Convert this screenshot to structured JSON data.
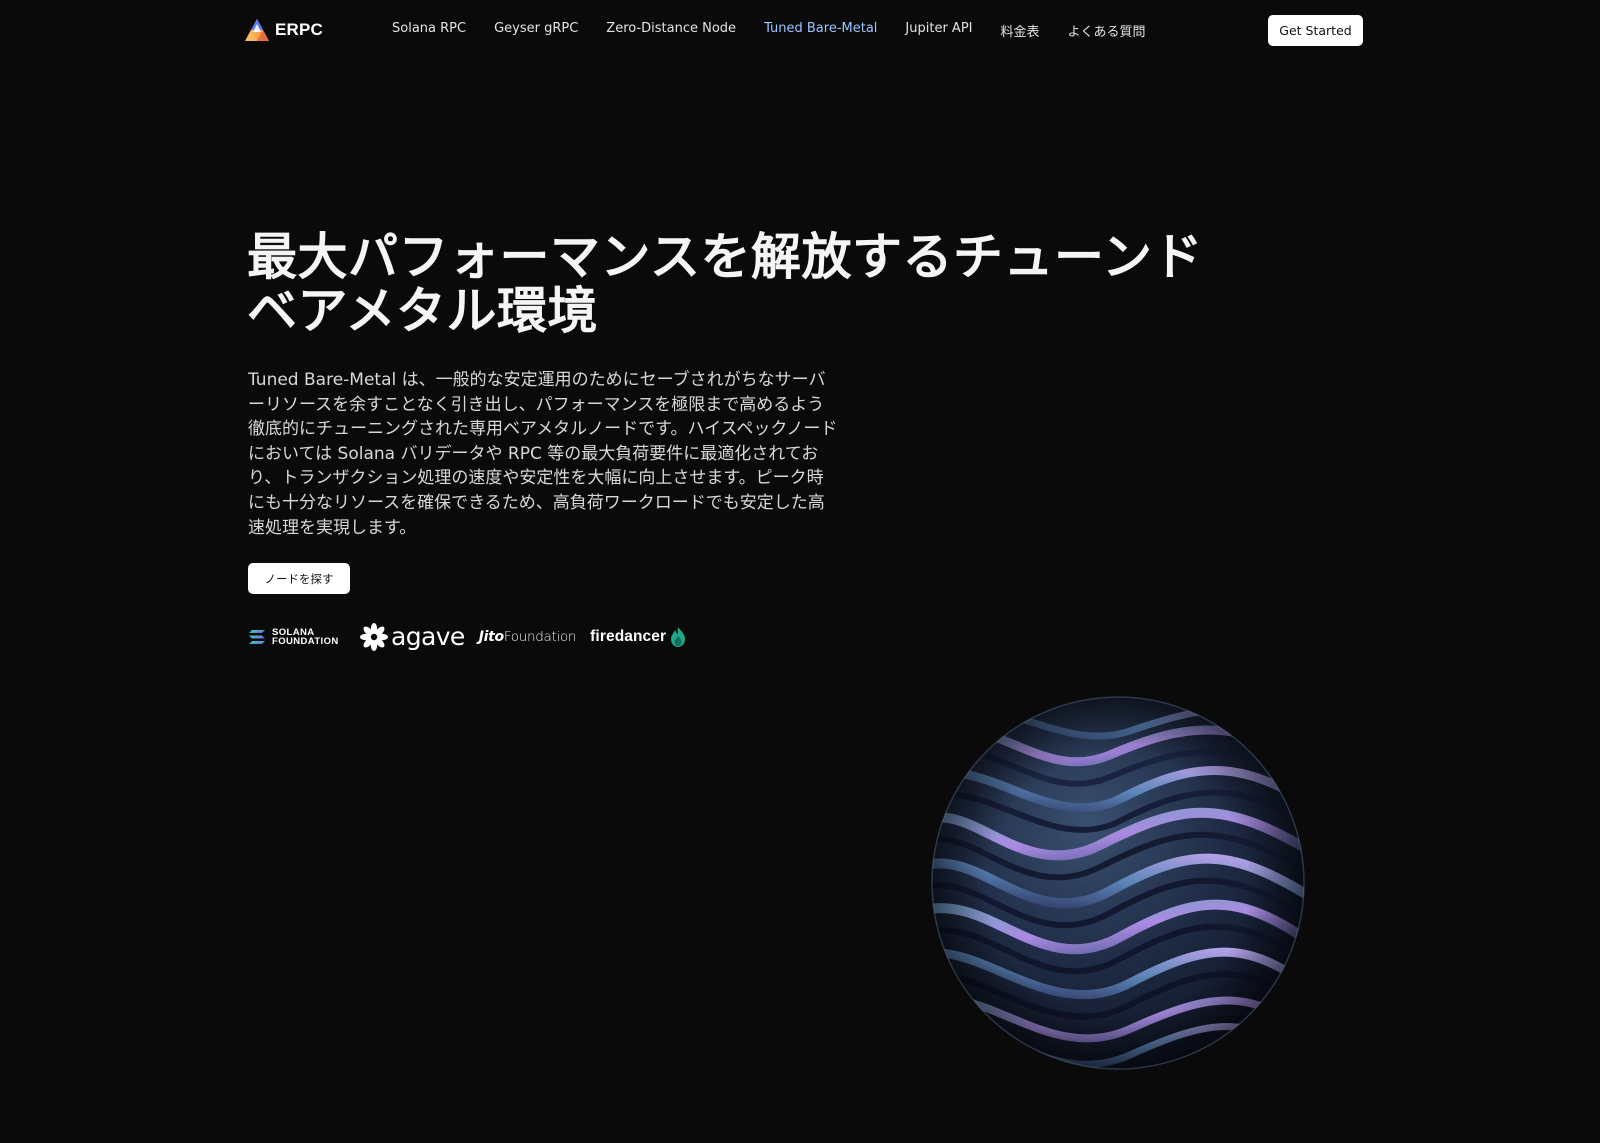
{
  "header": {
    "brand": "ERPC",
    "logo_icon": "erpc-triangle-logo",
    "nav": [
      {
        "label": "Solana RPC",
        "active": false
      },
      {
        "label": "Geyser gRPC",
        "active": false
      },
      {
        "label": "Zero-Distance Node",
        "active": false
      },
      {
        "label": "Tuned Bare-Metal",
        "active": true
      },
      {
        "label": "Jupiter API",
        "active": false
      },
      {
        "label": "料金表",
        "active": false
      },
      {
        "label": "よくある質問",
        "active": false
      }
    ],
    "cta_label": "Get Started"
  },
  "hero": {
    "title_line1": "最大パフォーマンスを解放するチューンド",
    "title_line2": "ベアメタル環境",
    "description": "Tuned Bare-Metal は、一般的な安定運用のためにセーブされがちなサーバーリソースを余すことなく引き出し、パフォーマンスを極限まで高めるよう徹底的にチューニングされた専用ベアメタルノードです。ハイスペックノードにおいては Solana バリデータや RPC 等の最大負荷要件に最適化されており、トランザクション処理の速度や安定性を大幅に向上させます。ピーク時にも十分なリソースを確保できるため、高負荷ワークロードでも安定した高速処理を実現します。",
    "button_label": "ノードを探す"
  },
  "partners": {
    "solana_line1": "SOLANA",
    "solana_line2": "FOUNDATION",
    "agave": "agave",
    "jito_bold": "Jito",
    "jito_light": "Foundation",
    "firedancer": "firedancer"
  },
  "colors": {
    "background": "#0a0a0a",
    "nav_active": "#9cc4ff",
    "button_bg": "#ffffff",
    "firedancer_flame": "#1fa88a"
  },
  "icons": {
    "solana": "solana-icon",
    "agave": "agave-flower-icon",
    "firedancer": "flame-icon",
    "hero_visual": "wavy-metallic-sphere"
  }
}
